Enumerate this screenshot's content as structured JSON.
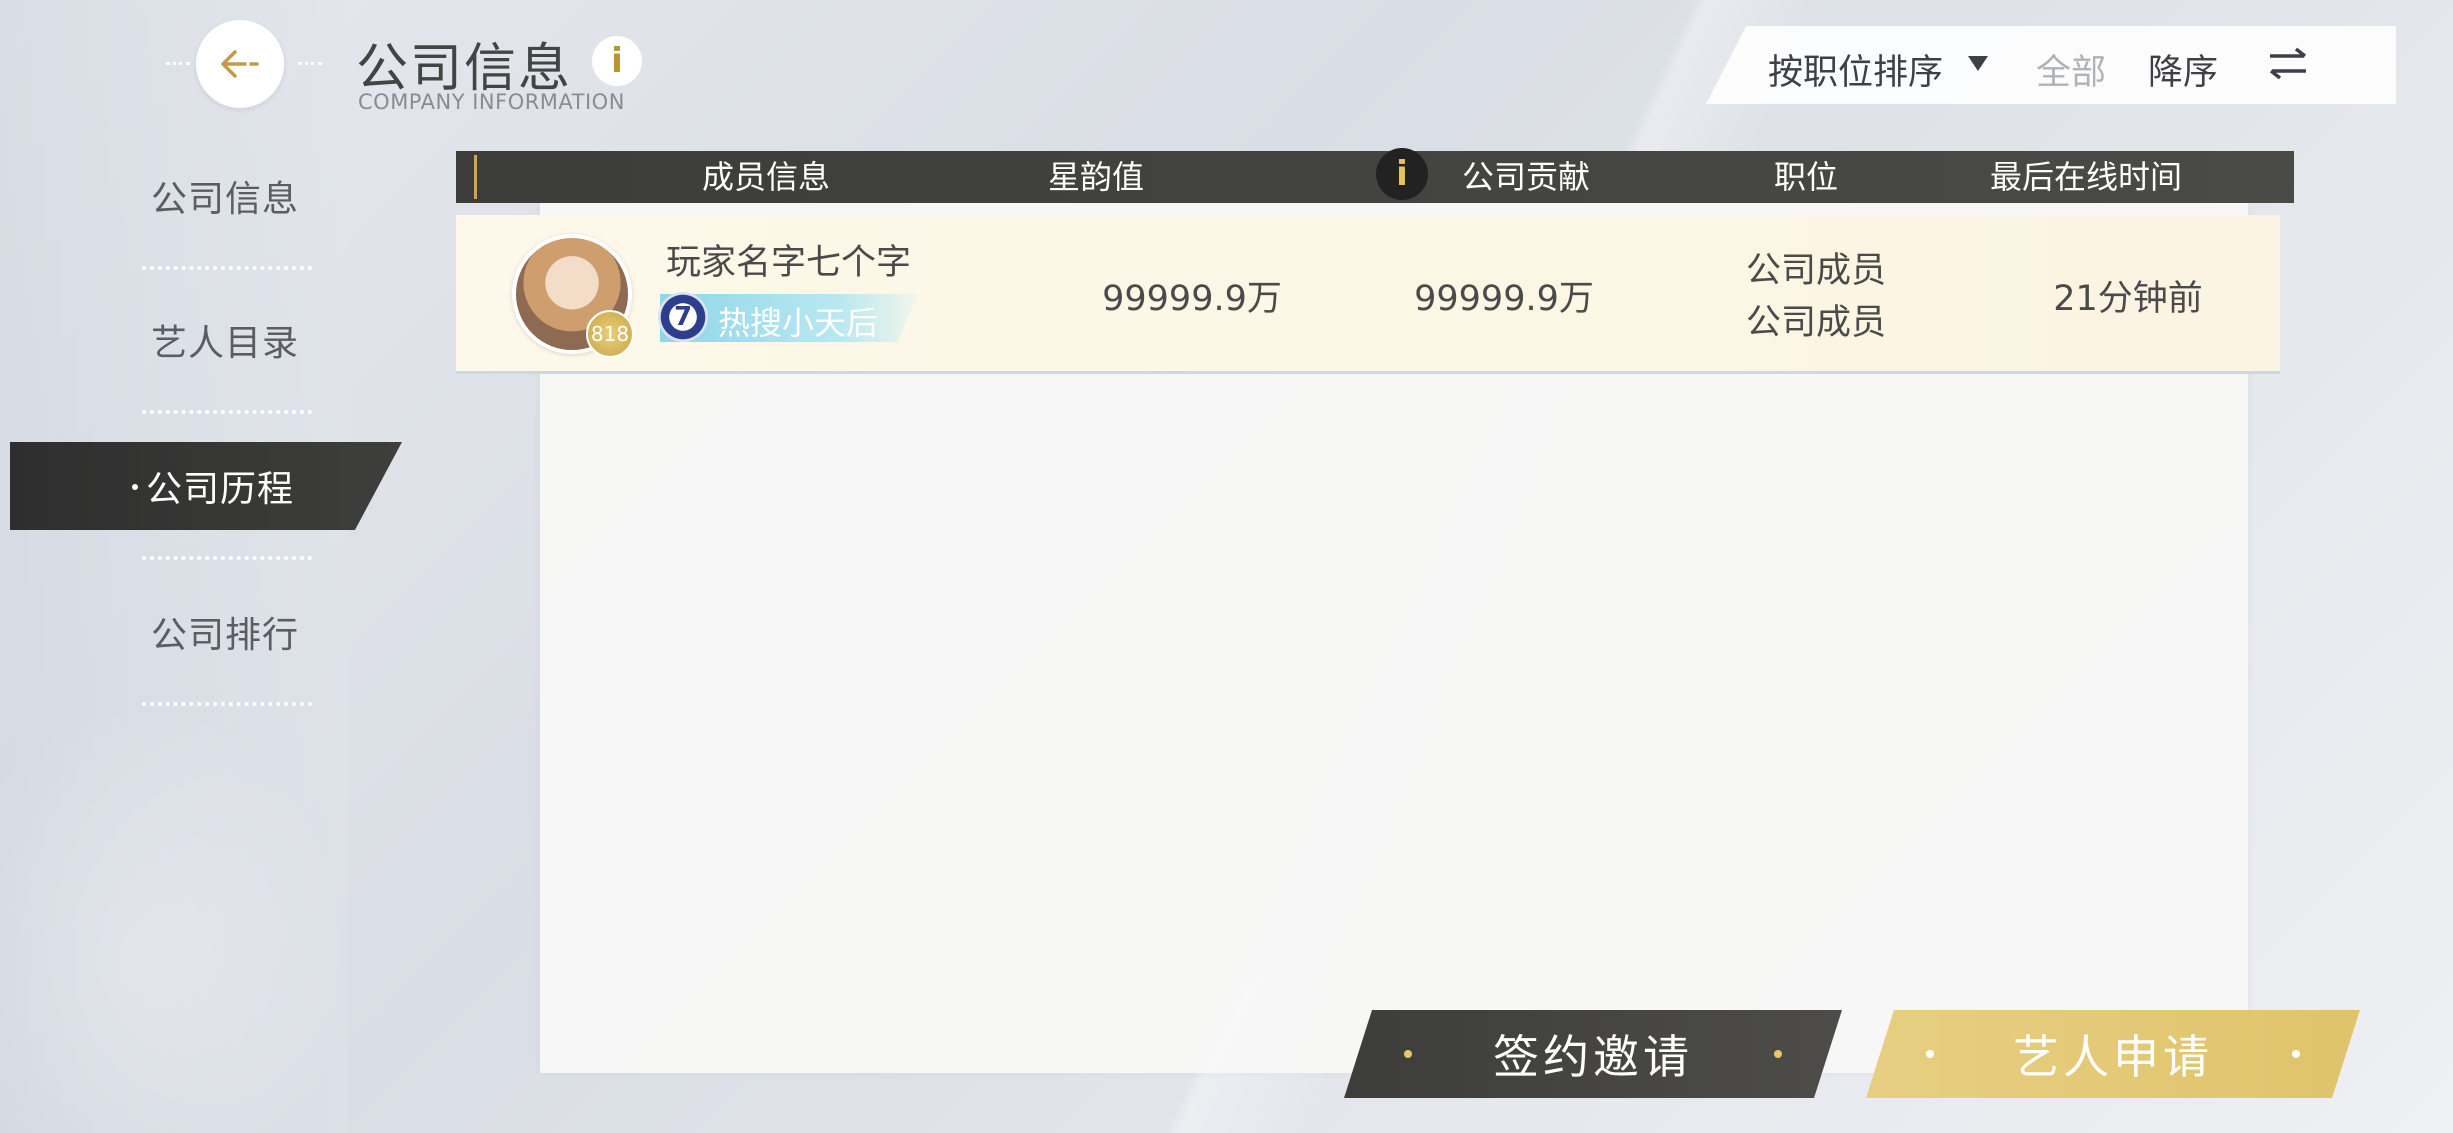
{
  "header": {
    "title": "公司信息",
    "subtitle": "COMPANY INFORMATION"
  },
  "sidebar": {
    "items": [
      {
        "label": "公司信息",
        "active": false
      },
      {
        "label": "艺人目录",
        "active": false
      },
      {
        "label": "公司历程",
        "active": true
      },
      {
        "label": "公司排行",
        "active": false
      }
    ]
  },
  "sort_bar": {
    "sort_by": "按职位排序",
    "filter": "全部",
    "order": "降序"
  },
  "table": {
    "columns": [
      "成员信息",
      "星韵值",
      "公司贡献",
      "职位",
      "最后在线时间"
    ],
    "rows": [
      {
        "player_name": "玩家名字七个字",
        "level": "818",
        "title_badge_number": "7",
        "title_tag": "热搜小天后",
        "star_value": "99999.9万",
        "contribution": "99999.9万",
        "position_line1": "公司成员",
        "position_line2": "公司成员",
        "last_online": "21分钟前"
      }
    ]
  },
  "buttons": {
    "sign_invite": "签约邀请",
    "artist_apply": "艺人申请"
  },
  "colors": {
    "accent_gold": "#c9a65a",
    "dark": "#3c3c3b",
    "apply_button": "#e3c873"
  }
}
